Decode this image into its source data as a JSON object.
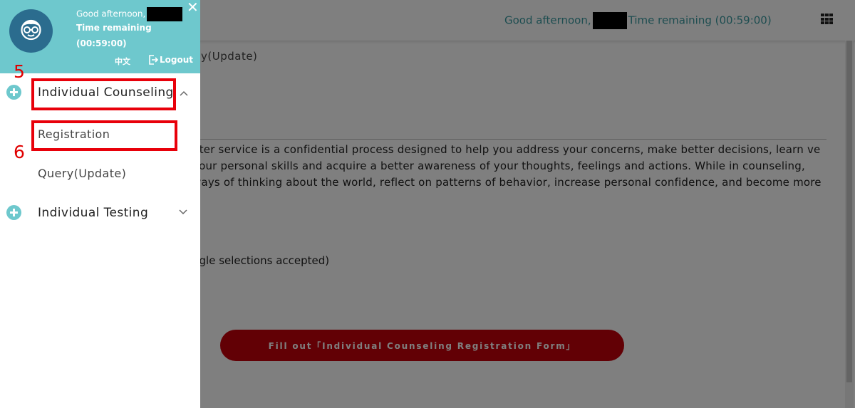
{
  "topbar": {
    "greeting": "Good afternoon,",
    "time_remaining": "Time remaining (00:59:00)",
    "apps_icon": "grid-icon"
  },
  "main": {
    "breadcrumb_tail": "y(Update)",
    "intro_text": "nter service is a confidential process designed to help you address your concerns, make better decisions, learn ve your personal skills and acquire a better awareness of your thoughts, feelings and actions. While in counseling, ways of thinking about the world, reflect on patterns of behavior, increase personal confidence, and become more",
    "selection_note": "ngle selections accepted)",
    "fill_button": "Fill out「Individual Counseling Registration Form」"
  },
  "drawer": {
    "greeting": "Good afternoon,",
    "time_label": "Time remaining",
    "time_value": "(00:59:00)",
    "close": "✕",
    "language": "中文",
    "logout": "Logout",
    "menu": [
      {
        "label": "Individual Counseling",
        "expanded": true,
        "submenu": [
          {
            "label": "Registration"
          },
          {
            "label": "Query(Update)"
          }
        ]
      },
      {
        "label": "Individual Testing",
        "expanded": false
      }
    ]
  },
  "annotations": {
    "step5": "5",
    "step6": "6"
  },
  "colors": {
    "drawer_header": "#6ec8cd",
    "avatar_bg": "#2b6c8e",
    "primary_button": "#c4000a",
    "annotation_red": "#e8000a",
    "greeting_text": "#3a9aa1"
  }
}
